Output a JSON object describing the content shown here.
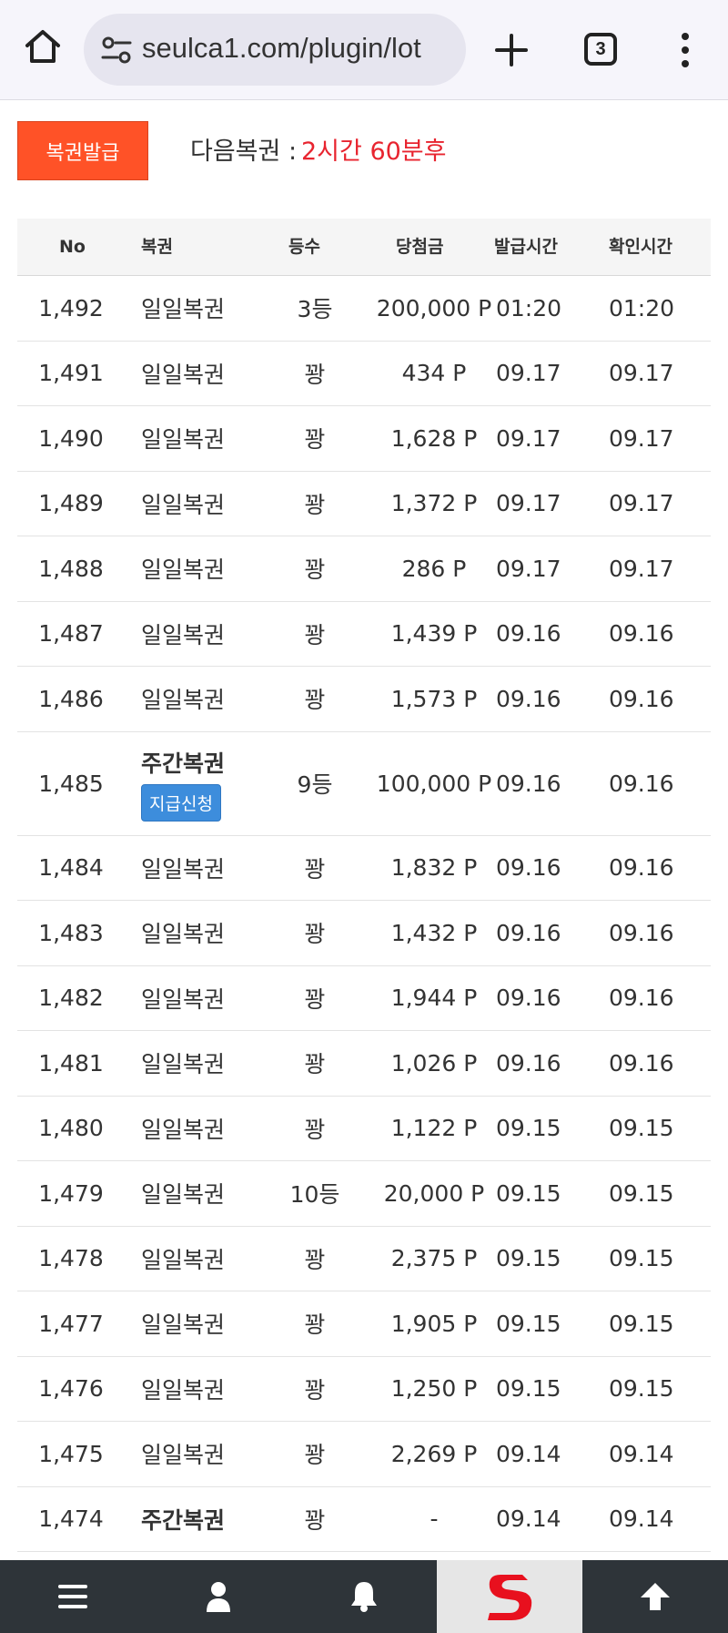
{
  "browser": {
    "url": "seulca1.com/plugin/lot",
    "tab_count": "3"
  },
  "toolbar": {
    "issue_label": "복권발급",
    "next_label": "다음복권 :",
    "next_value": "2시간 60분후"
  },
  "table": {
    "headers": {
      "no": "No",
      "type": "복권",
      "rank": "등수",
      "prize": "당첨금",
      "issued": "발급시간",
      "checked": "확인시간"
    },
    "claim_label": "지급신청",
    "rows": [
      {
        "no": "1,492",
        "type": "일일복권",
        "rank": "3등",
        "prize": "200,000 P",
        "issued": "01:20",
        "checked": "01:20"
      },
      {
        "no": "1,491",
        "type": "일일복권",
        "rank": "꽝",
        "prize": "434 P",
        "issued": "09.17",
        "checked": "09.17"
      },
      {
        "no": "1,490",
        "type": "일일복권",
        "rank": "꽝",
        "prize": "1,628 P",
        "issued": "09.17",
        "checked": "09.17"
      },
      {
        "no": "1,489",
        "type": "일일복권",
        "rank": "꽝",
        "prize": "1,372 P",
        "issued": "09.17",
        "checked": "09.17"
      },
      {
        "no": "1,488",
        "type": "일일복권",
        "rank": "꽝",
        "prize": "286 P",
        "issued": "09.17",
        "checked": "09.17"
      },
      {
        "no": "1,487",
        "type": "일일복권",
        "rank": "꽝",
        "prize": "1,439 P",
        "issued": "09.16",
        "checked": "09.16"
      },
      {
        "no": "1,486",
        "type": "일일복권",
        "rank": "꽝",
        "prize": "1,573 P",
        "issued": "09.16",
        "checked": "09.16"
      },
      {
        "no": "1,485",
        "type": "주간복권",
        "rank": "9등",
        "prize": "100,000 P",
        "issued": "09.16",
        "checked": "09.16"
      },
      {
        "no": "1,484",
        "type": "일일복권",
        "rank": "꽝",
        "prize": "1,832 P",
        "issued": "09.16",
        "checked": "09.16"
      },
      {
        "no": "1,483",
        "type": "일일복권",
        "rank": "꽝",
        "prize": "1,432 P",
        "issued": "09.16",
        "checked": "09.16"
      },
      {
        "no": "1,482",
        "type": "일일복권",
        "rank": "꽝",
        "prize": "1,944 P",
        "issued": "09.16",
        "checked": "09.16"
      },
      {
        "no": "1,481",
        "type": "일일복권",
        "rank": "꽝",
        "prize": "1,026 P",
        "issued": "09.16",
        "checked": "09.16"
      },
      {
        "no": "1,480",
        "type": "일일복권",
        "rank": "꽝",
        "prize": "1,122 P",
        "issued": "09.15",
        "checked": "09.15"
      },
      {
        "no": "1,479",
        "type": "일일복권",
        "rank": "10등",
        "prize": "20,000 P",
        "issued": "09.15",
        "checked": "09.15"
      },
      {
        "no": "1,478",
        "type": "일일복권",
        "rank": "꽝",
        "prize": "2,375 P",
        "issued": "09.15",
        "checked": "09.15"
      },
      {
        "no": "1,477",
        "type": "일일복권",
        "rank": "꽝",
        "prize": "1,905 P",
        "issued": "09.15",
        "checked": "09.15"
      },
      {
        "no": "1,476",
        "type": "일일복권",
        "rank": "꽝",
        "prize": "1,250 P",
        "issued": "09.15",
        "checked": "09.15"
      },
      {
        "no": "1,475",
        "type": "일일복권",
        "rank": "꽝",
        "prize": "2,269 P",
        "issued": "09.14",
        "checked": "09.14"
      },
      {
        "no": "1,474",
        "type": "주간복권",
        "rank": "꽝",
        "prize": "-",
        "issued": "09.14",
        "checked": "09.14"
      }
    ]
  },
  "bottom_nav": {
    "items": [
      "menu-icon",
      "user-icon",
      "bell-icon",
      "site-logo",
      "arrow-up-icon"
    ]
  },
  "colors": {
    "issue_button": "#ff5227",
    "next_value": "#e8242f",
    "claim_button": "#3d8ddc",
    "bottom_nav": "#2e3439"
  }
}
